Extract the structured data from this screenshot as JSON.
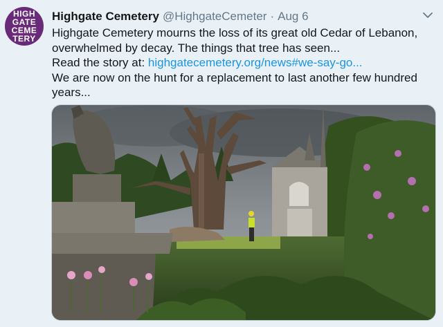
{
  "avatar": {
    "lines": [
      "HIGH",
      "GATE",
      "CEME",
      "TERY"
    ]
  },
  "tweet": {
    "display_name": "Highgate Cemetery",
    "handle": "@HighgateCemeter",
    "separator": "·",
    "date": "Aug 6",
    "text_line1": "Highgate Cemetery mourns the loss of its great old Cedar of Lebanon, overwhelmed by decay.  The things that tree has seen...",
    "text_prefix": "Read the story at: ",
    "link_text": "highgatecemetery.org/news#we-say-go...",
    "text_line3": "We are now on the hunt for a replacement to last another few hundred years..."
  },
  "icons": {
    "menu": "chevron-down-icon"
  },
  "media": {
    "description_icon": "photo",
    "colors": {
      "sky": "#7f858b",
      "foliage": "#3f5c2a",
      "stone": "#8a8579",
      "accent_purple": "#b36fb0",
      "worker_vest": "#c9e02a"
    }
  }
}
